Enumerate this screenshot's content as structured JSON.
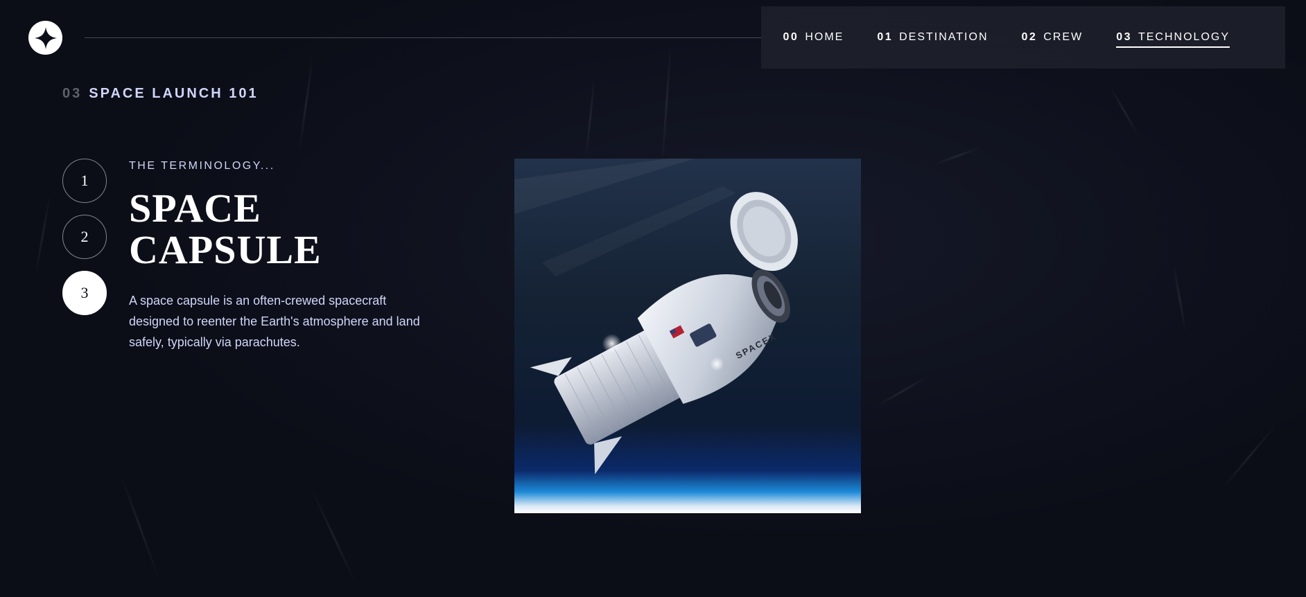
{
  "nav": {
    "items": [
      {
        "num": "00",
        "label": "HOME"
      },
      {
        "num": "01",
        "label": "DESTINATION"
      },
      {
        "num": "02",
        "label": "CREW"
      },
      {
        "num": "03",
        "label": "TECHNOLOGY"
      }
    ],
    "active_index": 3
  },
  "page": {
    "heading_num": "03",
    "heading_label": "SPACE LAUNCH 101"
  },
  "steps": [
    "1",
    "2",
    "3"
  ],
  "active_step": 3,
  "content": {
    "eyebrow": "THE TERMINOLOGY...",
    "title_line1": "SPACE",
    "title_line2": "CAPSULE",
    "description": "A space capsule is an often-crewed spacecraft designed to reenter the Earth's atmosphere and land safely, typically via parachutes."
  },
  "image": {
    "icon": "space-capsule-image",
    "capsule_text": "SPACEX"
  },
  "colors": {
    "background": "#0b0d17",
    "accent_text": "#d0d6f9",
    "white": "#ffffff"
  }
}
